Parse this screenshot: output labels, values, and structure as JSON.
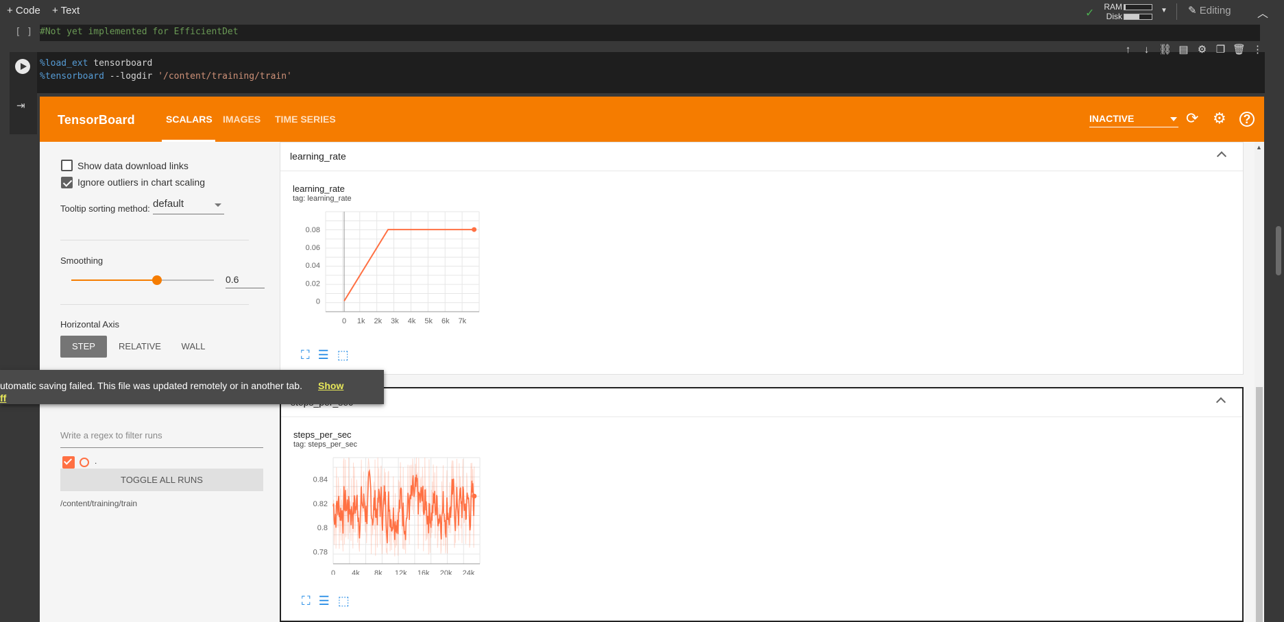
{
  "toolbar": {
    "code_label": "+ Code",
    "text_label": "+ Text",
    "ram_label": "RAM",
    "disk_label": "Disk",
    "ram_level": 0.05,
    "disk_level": 0.55,
    "editing_label": "Editing"
  },
  "cells": {
    "cell1": {
      "bracket": "[ ]",
      "code": "#Not yet implemented for EfficientDet"
    },
    "cell2": {
      "line1_magic": "%load_ext",
      "line1_rest": " tensorboard",
      "line2_magic": "%tensorboard",
      "line2_rest": " --logdir ",
      "line2_str": "'/content/training/train'"
    }
  },
  "tensorboard": {
    "title": "TensorBoard",
    "tabs": [
      "SCALARS",
      "IMAGES",
      "TIME SERIES"
    ],
    "status": "INACTIVE",
    "sidebar": {
      "show_download_links": "Show data download links",
      "ignore_outliers": "Ignore outliers in chart scaling",
      "tooltip_label": "Tooltip sorting method:",
      "tooltip_value": "default",
      "smoothing_label": "Smoothing",
      "smoothing_value": "0.6",
      "horizontal_axis_label": "Horizontal Axis",
      "axis_options": [
        "STEP",
        "RELATIVE",
        "WALL"
      ],
      "regex_placeholder": "Write a regex to filter runs",
      "run_dot": ".",
      "toggle_all": "TOGGLE ALL RUNS",
      "run_path": "/content/training/train"
    },
    "cards": [
      {
        "header": "learning_rate",
        "title": "learning_rate",
        "tag": "tag: learning_rate"
      },
      {
        "header": "steps_per_sec",
        "title": "steps_per_sec",
        "tag": "tag: steps_per_sec"
      }
    ]
  },
  "toast": {
    "message": "utomatic saving failed. This file was updated remotely or in another tab.",
    "action": "Show",
    "extra": "ff"
  },
  "chart_data": [
    {
      "type": "line",
      "x": [
        0,
        2600,
        7700
      ],
      "y": [
        0,
        0.08,
        0.08
      ],
      "xlim": [
        -1100,
        8000
      ],
      "ylim": [
        -0.012,
        0.1
      ],
      "xticks": [
        "0",
        "1k",
        "2k",
        "3k",
        "4k",
        "5k",
        "6k",
        "7k"
      ],
      "yticks": [
        "0",
        "0.02",
        "0.04",
        "0.06",
        "0.08"
      ],
      "color": "#ff7043"
    },
    {
      "type": "line",
      "xlim": [
        0,
        26000
      ],
      "ylim": [
        0.77,
        0.858
      ],
      "xticks": [
        "0",
        "4k",
        "8k",
        "12k",
        "16k",
        "20k",
        "24k"
      ],
      "yticks": [
        "0.78",
        "0.8",
        "0.82",
        "0.84"
      ],
      "series_range": [
        0.776,
        0.86
      ],
      "x_end": 25000,
      "color": "#ff7043"
    }
  ]
}
